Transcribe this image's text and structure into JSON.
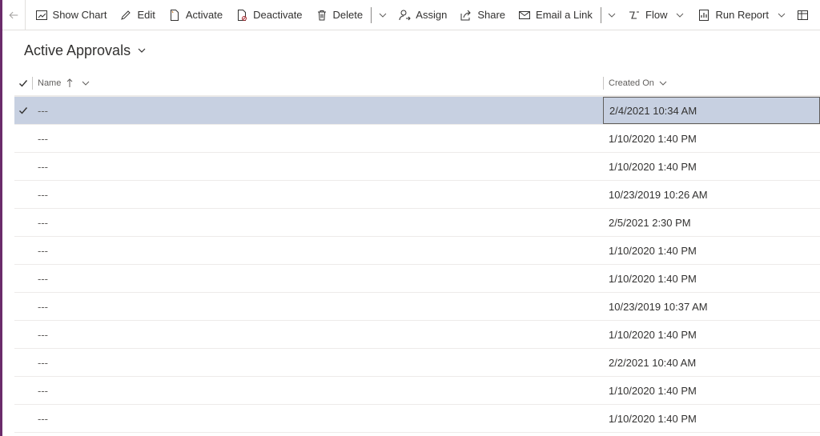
{
  "toolbar": {
    "items": [
      {
        "label": "Show Chart",
        "icon": "chart-icon"
      },
      {
        "label": "Edit",
        "icon": "pencil-icon"
      },
      {
        "label": "Activate",
        "icon": "document-activate-icon"
      },
      {
        "label": "Deactivate",
        "icon": "document-deactivate-icon"
      },
      {
        "label": "Delete",
        "icon": "trash-icon"
      },
      {
        "label": "Assign",
        "icon": "person-assign-icon"
      },
      {
        "label": "Share",
        "icon": "share-icon"
      },
      {
        "label": "Email a Link",
        "icon": "email-icon"
      },
      {
        "label": "Flow",
        "icon": "flow-icon"
      },
      {
        "label": "Run Report",
        "icon": "report-icon"
      }
    ]
  },
  "view": {
    "title": "Active Approvals"
  },
  "grid": {
    "columns": {
      "name": "Name",
      "created_on": "Created On"
    },
    "rows": [
      {
        "name": "---",
        "created_on": "2/4/2021 10:34 AM",
        "selected": true
      },
      {
        "name": "---",
        "created_on": "1/10/2020 1:40 PM",
        "selected": false
      },
      {
        "name": "---",
        "created_on": "1/10/2020 1:40 PM",
        "selected": false
      },
      {
        "name": "---",
        "created_on": "10/23/2019 10:26 AM",
        "selected": false
      },
      {
        "name": "---",
        "created_on": "2/5/2021 2:30 PM",
        "selected": false
      },
      {
        "name": "---",
        "created_on": "1/10/2020 1:40 PM",
        "selected": false
      },
      {
        "name": "---",
        "created_on": "1/10/2020 1:40 PM",
        "selected": false
      },
      {
        "name": "---",
        "created_on": "10/23/2019 10:37 AM",
        "selected": false
      },
      {
        "name": "---",
        "created_on": "1/10/2020 1:40 PM",
        "selected": false
      },
      {
        "name": "---",
        "created_on": "2/2/2021 10:40 AM",
        "selected": false
      },
      {
        "name": "---",
        "created_on": "1/10/2020 1:40 PM",
        "selected": false
      },
      {
        "name": "---",
        "created_on": "1/10/2020 1:40 PM",
        "selected": false
      }
    ]
  },
  "colors": {
    "accent_rail": "#6b2b6b",
    "selected_row": "#c7d0e1"
  }
}
